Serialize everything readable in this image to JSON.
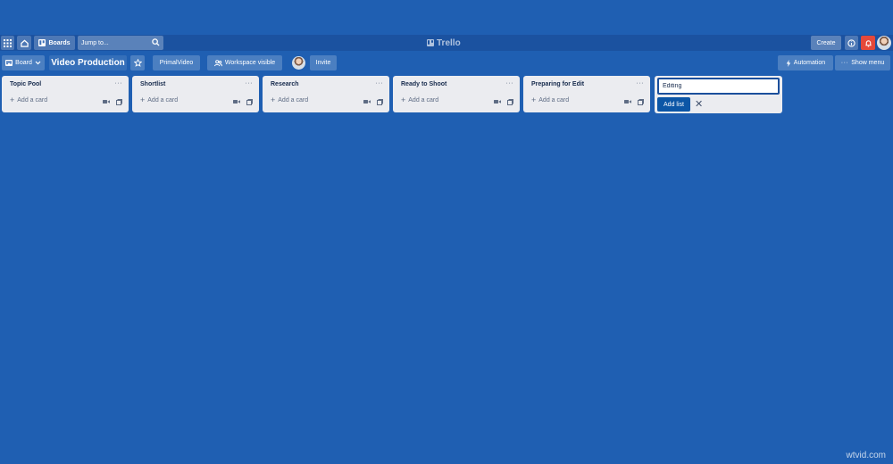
{
  "topbar": {
    "boards_label": "Boards",
    "search_placeholder": "Jump to...",
    "logo_text": "Trello",
    "create_label": "Create"
  },
  "boardbar": {
    "view_label": "Board",
    "board_title": "Video Production",
    "workspace_label": "PrimalVideo",
    "visibility_label": "Workspace visible",
    "invite_label": "Invite",
    "automation_label": "Automation",
    "show_menu_label": "Show menu"
  },
  "lists": [
    {
      "title": "Topic Pool",
      "add_card": "Add a card"
    },
    {
      "title": "Shortlist",
      "add_card": "Add a card"
    },
    {
      "title": "Research",
      "add_card": "Add a card"
    },
    {
      "title": "Ready to Shoot",
      "add_card": "Add a card"
    },
    {
      "title": "Preparing for Edit",
      "add_card": "Add a card"
    }
  ],
  "add_list": {
    "input_value": "Editing",
    "button_label": "Add list"
  },
  "watermark": "wtvid.com",
  "colors": {
    "background": "#1f5fb2",
    "list_bg": "#ebecf0",
    "primary_button": "#0c56a6",
    "notification": "#e5493a"
  }
}
